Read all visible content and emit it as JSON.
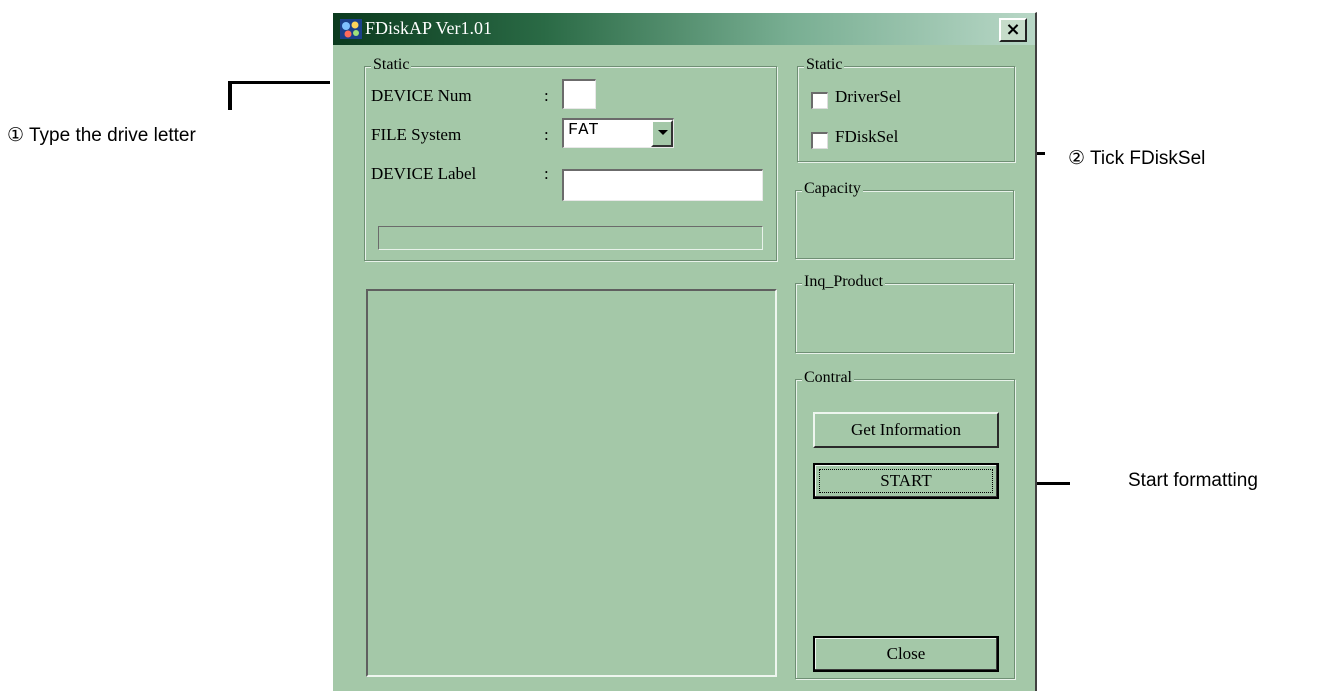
{
  "annotations": {
    "step1": "① Type the drive letter",
    "step2": "② Tick FDiskSel",
    "step3": "Start formatting"
  },
  "window": {
    "title": "FDiskAP Ver1.01",
    "close_label": "×"
  },
  "device_group": {
    "label": "Static",
    "device_num_label": "DEVICE Num",
    "device_num_value": "",
    "file_system_label": "FILE System",
    "file_system_value": "FAT",
    "device_label_label": "DEVICE Label",
    "device_label_value": "",
    "colon": ":"
  },
  "select_group": {
    "label": "Static",
    "driver_sel": "DriverSel",
    "fdisk_sel": "FDiskSel"
  },
  "capacity_group": {
    "label": "Capacity"
  },
  "inq_group": {
    "label": "Inq_Product"
  },
  "control_group": {
    "label": "Contral",
    "get_info": "Get Information",
    "start": "START",
    "close": "Close"
  },
  "icons": {
    "app": "app-icon",
    "close": "close-icon",
    "dropdown": "chevron-down-icon"
  }
}
